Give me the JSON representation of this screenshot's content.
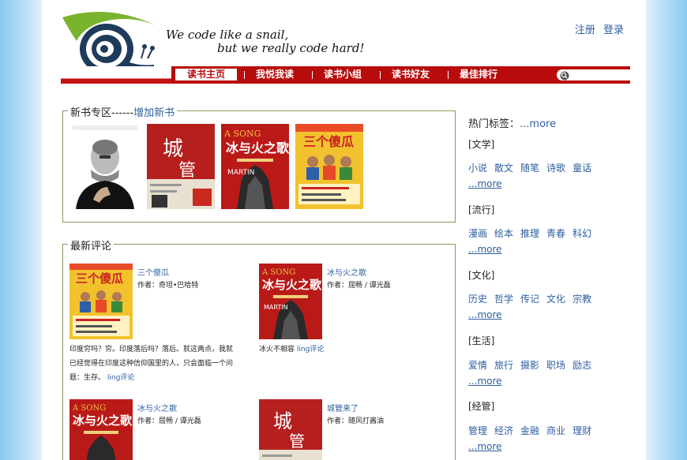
{
  "header": {
    "slogan_line1": "We code like a snail,",
    "slogan_line2": "but we really code hard!",
    "register": "注册",
    "login": "登录"
  },
  "nav": {
    "items": [
      "读书主页",
      "我悦我读",
      "读书小组",
      "读书好友",
      "最佳排行"
    ],
    "active_index": 0,
    "search_icon": "search-icon"
  },
  "new_books": {
    "legend_prefix": "新书专区------",
    "add_link": "增加新书",
    "covers": [
      "steve-jobs-cover",
      "chengguan-cover",
      "song-of-ice-and-fire-cover",
      "three-idiots-cover"
    ]
  },
  "reviews": {
    "legend": "最新评论",
    "items": [
      {
        "title": "三个傻瓜",
        "author": "作者：奇坦•巴哈特",
        "text": "印度穷吗？穷。印度落后吗？落后。就这两点，我就已经觉得在印度这种信仰国里的人，只会面临一个问题：生存。",
        "link": "ling评论",
        "cover": "three-idiots-cover"
      },
      {
        "title": "冰与火之歌",
        "author": "作者：屈畅 / 谭光磊",
        "text": "冰火不相容",
        "link": "ling评论",
        "cover": "song-of-ice-and-fire-cover"
      },
      {
        "title": "冰与火之歌",
        "author": "作者：屈畅 / 谭光磊",
        "text": "",
        "link": "",
        "cover": "song-of-ice-and-fire-cover"
      },
      {
        "title": "城管来了",
        "author": "作者：随风打酱油",
        "text": "",
        "link": "",
        "cover": "chengguan-cover"
      }
    ]
  },
  "sidebar": {
    "hot_label": "热门标签：",
    "hot_more": "...more",
    "categories": [
      {
        "name": "[文学]",
        "tags": [
          "小说",
          "散文",
          "随笔",
          "诗歌",
          "童话"
        ],
        "more": "...more"
      },
      {
        "name": "[流行]",
        "tags": [
          "漫画",
          "绘本",
          "推理",
          "青春",
          "科幻"
        ],
        "more": "...more"
      },
      {
        "name": "[文化]",
        "tags": [
          "历史",
          "哲学",
          "传记",
          "文化",
          "宗教"
        ],
        "more": "...more"
      },
      {
        "name": "[生活]",
        "tags": [
          "爱情",
          "旅行",
          "摄影",
          "职场",
          "励志"
        ],
        "more": "...more"
      },
      {
        "name": "[经管]",
        "tags": [
          "管理",
          "经济",
          "金融",
          "商业",
          "理财"
        ],
        "more": "...more"
      }
    ]
  },
  "colors": {
    "nav_red": "#b80c0c",
    "link_blue": "#2d5f9e",
    "box_border": "#8a9a5b"
  }
}
